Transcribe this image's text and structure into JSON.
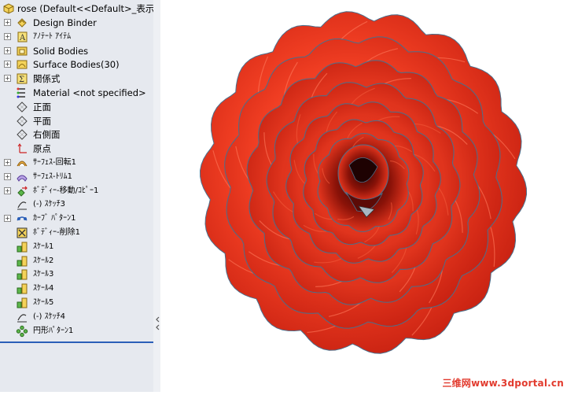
{
  "tree": {
    "root": "rose  (Default<<Default>_表示",
    "items": [
      {
        "label": "Design Binder",
        "icon": "design-binder-icon",
        "expander": true
      },
      {
        "label": "ｱﾉﾃｰﾄ ｱｲﾃﾑ",
        "icon": "annotations-icon",
        "expander": true
      },
      {
        "label": "Solid Bodies",
        "icon": "solid-bodies-icon",
        "expander": true
      },
      {
        "label": "Surface Bodies(30)",
        "icon": "surface-bodies-icon",
        "expander": true
      },
      {
        "label": "関係式",
        "icon": "equations-icon",
        "expander": true
      },
      {
        "label": "Material <not specified>",
        "icon": "material-icon",
        "expander": false
      },
      {
        "label": "正面",
        "icon": "plane-icon",
        "expander": false
      },
      {
        "label": "平面",
        "icon": "plane-icon",
        "expander": false
      },
      {
        "label": "右側面",
        "icon": "plane-icon",
        "expander": false
      },
      {
        "label": "原点",
        "icon": "origin-icon",
        "expander": false
      },
      {
        "label": "ｻｰﾌｪｽ-回転1",
        "icon": "surface-revolve-icon",
        "expander": true
      },
      {
        "label": "ｻｰﾌｪｽ-ﾄﾘﾑ1",
        "icon": "surface-trim-icon",
        "expander": true
      },
      {
        "label": "ﾎﾞﾃﾞｨｰ-移動/ｺﾋﾟｰ1",
        "icon": "body-move-icon",
        "expander": true
      },
      {
        "label": "(-) ｽｹｯﾁ3",
        "icon": "sketch-icon",
        "expander": false
      },
      {
        "label": "ｶｰﾌﾞ ﾊﾟﾀｰﾝ1",
        "icon": "curve-pattern-icon",
        "expander": true
      },
      {
        "label": "ﾎﾞﾃﾞｨｰ-削除1",
        "icon": "body-delete-icon",
        "expander": false
      },
      {
        "label": "ｽｹｰﾙ1",
        "icon": "scale-icon",
        "expander": false
      },
      {
        "label": "ｽｹｰﾙ2",
        "icon": "scale-icon",
        "expander": false
      },
      {
        "label": "ｽｹｰﾙ3",
        "icon": "scale-icon",
        "expander": false
      },
      {
        "label": "ｽｹｰﾙ4",
        "icon": "scale-icon",
        "expander": false
      },
      {
        "label": "ｽｹｰﾙ5",
        "icon": "scale-icon",
        "expander": false
      },
      {
        "label": "(-) ｽｹｯﾁ4",
        "icon": "sketch-icon",
        "expander": false
      },
      {
        "label": "円形ﾊﾟﾀｰﾝ1",
        "icon": "circular-pattern-icon",
        "expander": false
      }
    ]
  },
  "watermark": "三维网www.3dportal.cn",
  "colors": {
    "petal_light": "#ff5a3c",
    "petal_mid": "#e8321e",
    "petal_dark": "#7a0d08",
    "edge": "#4a6f8c",
    "accent": "#2b5fb8"
  }
}
